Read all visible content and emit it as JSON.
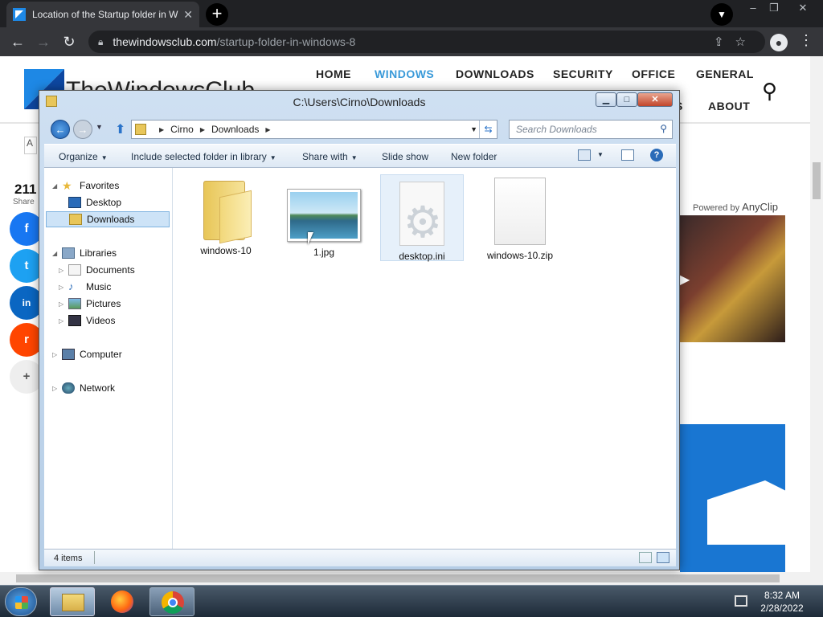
{
  "browser": {
    "tab_title": "Location of the Startup folder in W",
    "tab_close": "✕",
    "new_tab": "+",
    "url_host": "thewindowsclub.com",
    "url_path": "/startup-folder-in-windows-8",
    "window_controls": [
      "–",
      "❐",
      "✕"
    ]
  },
  "site": {
    "logo": "TheWindowsClub",
    "nav": [
      "HOME",
      "WINDOWS",
      "DOWNLOADS",
      "SECURITY",
      "OFFICE",
      "GENERAL",
      "S",
      "ABOUT"
    ],
    "nav_active_color": "#3a9ad9",
    "share_count": "211",
    "share_label": "Share",
    "font_toggle": "A",
    "social": [
      "f",
      "t",
      "in",
      "r",
      "+"
    ],
    "powered_by": "Powered by",
    "powered_brand": "AnyClip"
  },
  "explorer": {
    "title": "C:\\Users\\Cirno\\Downloads",
    "breadcrumb": [
      "Cirno",
      "Downloads"
    ],
    "search_placeholder": "Search Downloads",
    "commands": [
      "Organize",
      "Include selected folder in library",
      "Share with",
      "Slide show",
      "New folder"
    ],
    "nav": {
      "favorites": "Favorites",
      "fav_items": [
        "Desktop",
        "Downloads"
      ],
      "libraries": "Libraries",
      "lib_items": [
        "Documents",
        "Music",
        "Pictures",
        "Videos"
      ],
      "computer": "Computer",
      "network": "Network"
    },
    "files": [
      {
        "name": "windows-10",
        "icon": "folder-icon"
      },
      {
        "name": "1.jpg",
        "icon": "image-icon"
      },
      {
        "name": "desktop.ini",
        "icon": "settings-file-icon"
      },
      {
        "name": "windows-10.zip",
        "icon": "blank-file-icon"
      }
    ],
    "status": "4 items"
  },
  "taskbar": {
    "time": "8:32 AM",
    "date": "2/28/2022",
    "pinned": [
      "explorer-icon",
      "firefox-icon",
      "chrome-icon"
    ]
  }
}
